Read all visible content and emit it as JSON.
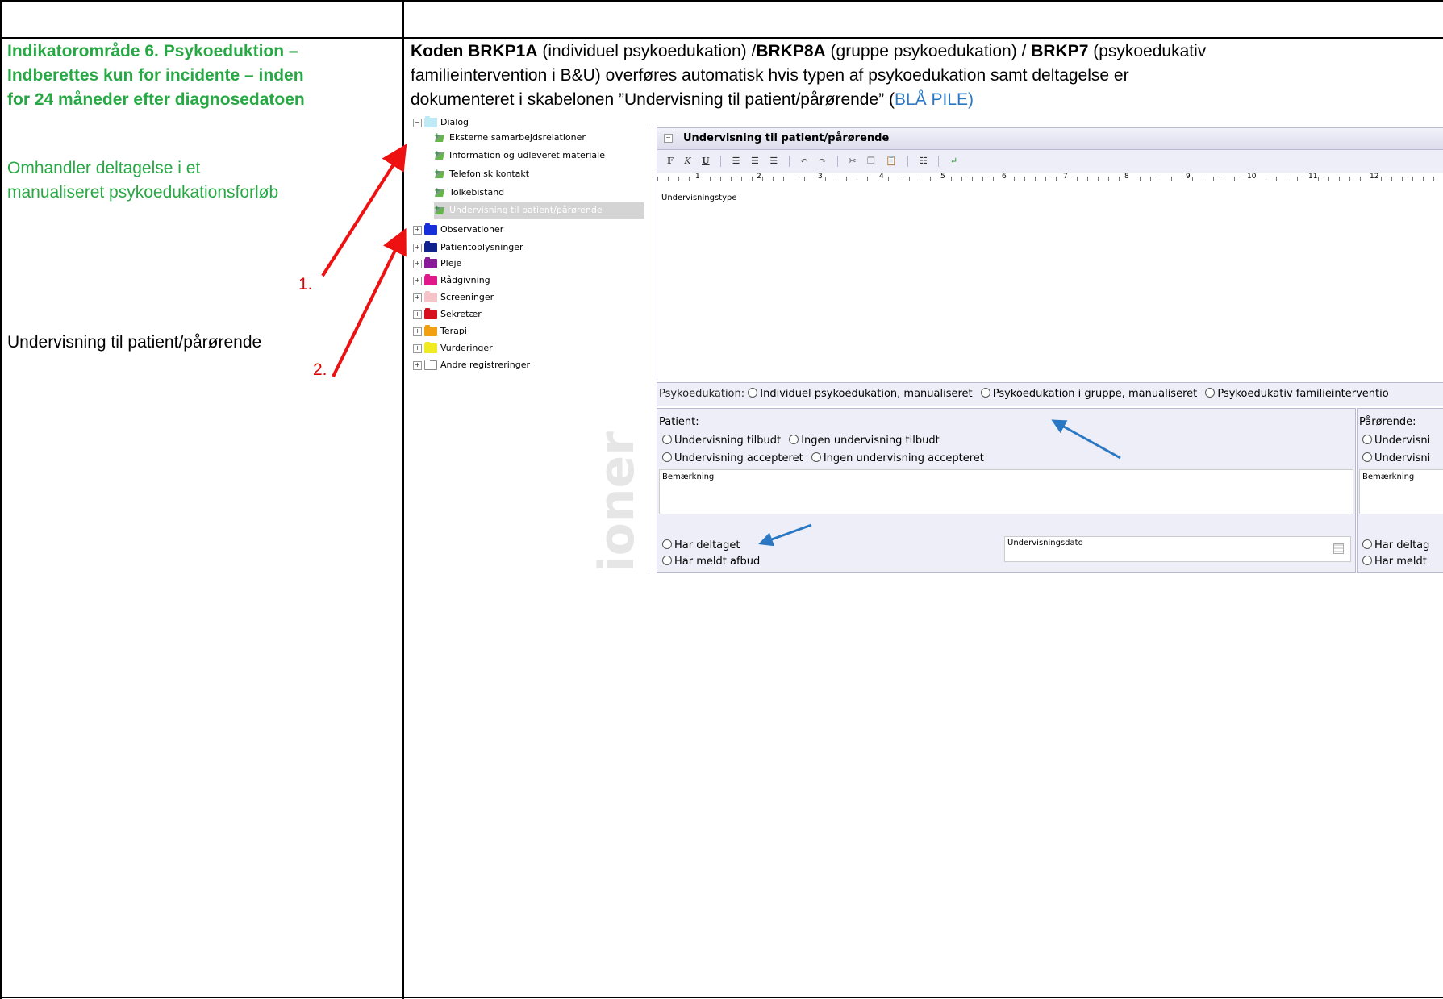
{
  "left": {
    "heading_lines": [
      "Indikatorområde 6. Psykoeduktion –",
      "Indberettes kun for incidente – inden",
      "for 24 måneder efter diagnosedatoen"
    ],
    "desc_lines": [
      "Omhandler deltagelse i et",
      "manualiseret psykoedukationsforløb"
    ],
    "template_name": "Undervisning til patient/pårørende",
    "marker1": "1.",
    "marker2": "2."
  },
  "right": {
    "line1": {
      "p1": "Koden BRKP1A",
      "p2": " (individuel psykoedukation) /",
      "p3": "BRKP8A",
      "p4": " (gruppe psykoedukation) / ",
      "p5": "BRKP7",
      "p6": " (psykoedukativ"
    },
    "line2": "familieintervention i B&U) overføres automatisk hvis typen af psykoedukation samt deltagelse er",
    "line3": {
      "p1": "dokumenteret i skabelonen ”Undervisning til patient/pårørende” (",
      "p2": "BLÅ PILE)"
    }
  },
  "tree": {
    "items": [
      {
        "label": "Dialog",
        "type": "folder",
        "color": "#bfe9f4",
        "sign": "−"
      },
      {
        "label": "Eksterne samarbejdsrelationer",
        "type": "leaf"
      },
      {
        "label": "Information og udleveret materiale",
        "type": "leaf"
      },
      {
        "label": "Telefonisk kontakt",
        "type": "leaf"
      },
      {
        "label": "Tolkebistand",
        "type": "leaf"
      },
      {
        "label": "Undervisning til patient/pårørende",
        "type": "leaf",
        "selected": true
      },
      {
        "label": "Observationer",
        "type": "folder",
        "color": "#1530d8",
        "sign": "+"
      },
      {
        "label": "Patientoplysninger",
        "type": "folder",
        "color": "#12228c",
        "sign": "+"
      },
      {
        "label": "Pleje",
        "type": "folder",
        "color": "#8a1a9a",
        "sign": "+"
      },
      {
        "label": "Rådgivning",
        "type": "folder",
        "color": "#e0198a",
        "sign": "+"
      },
      {
        "label": "Screeninger",
        "type": "folder",
        "color": "#f5c4c8",
        "sign": "+"
      },
      {
        "label": "Sekretær",
        "type": "folder",
        "color": "#d8101e",
        "sign": "+"
      },
      {
        "label": "Terapi",
        "type": "folder",
        "color": "#f0a010",
        "sign": "+"
      },
      {
        "label": "Vurderinger",
        "type": "folder",
        "color": "#f0ea20",
        "sign": "+"
      },
      {
        "label": "Andre registreringer",
        "type": "folder",
        "color": "#ffffff",
        "sign": "+"
      }
    ]
  },
  "panel": {
    "title": "Undervisning til patient/pårørende",
    "toolbar": [
      "F",
      "K",
      "U"
    ],
    "ruler_numbers": [
      "1",
      "2",
      "3",
      "4",
      "5",
      "6",
      "7",
      "8",
      "9",
      "10",
      "11",
      "12"
    ],
    "text_label": "Undervisningstype",
    "psyko_label": "Psykoedukation:",
    "psyko_options": [
      "Individuel psykoedukation, manualiseret",
      "Psykoedukation i gruppe, manualiseret",
      "Psykoedukativ familieinterventio"
    ],
    "patient": {
      "title": "Patient:",
      "row1": [
        "Undervisning tilbudt",
        "Ingen undervisning tilbudt"
      ],
      "row2": [
        "Undervisning accepteret",
        "Ingen undervisning accepteret"
      ],
      "remark": "Bemærkning",
      "participated": "Har deltaget",
      "cancelled": "Har meldt afbud",
      "date_label": "Undervisningsdato"
    },
    "relative": {
      "title": "Pårørende:",
      "row1": "Undervisni",
      "row2": "Undervisni",
      "remark": "Bemærkning",
      "participated": "Har deltag",
      "cancelled": "Har meldt"
    },
    "watermark": "ioner"
  },
  "colors": {
    "green": "#27a844",
    "red": "#e00000",
    "blue_arrow": "#2a78c4",
    "panel_bg": "#eeeef8",
    "selected_row": "#d4d4d4"
  }
}
